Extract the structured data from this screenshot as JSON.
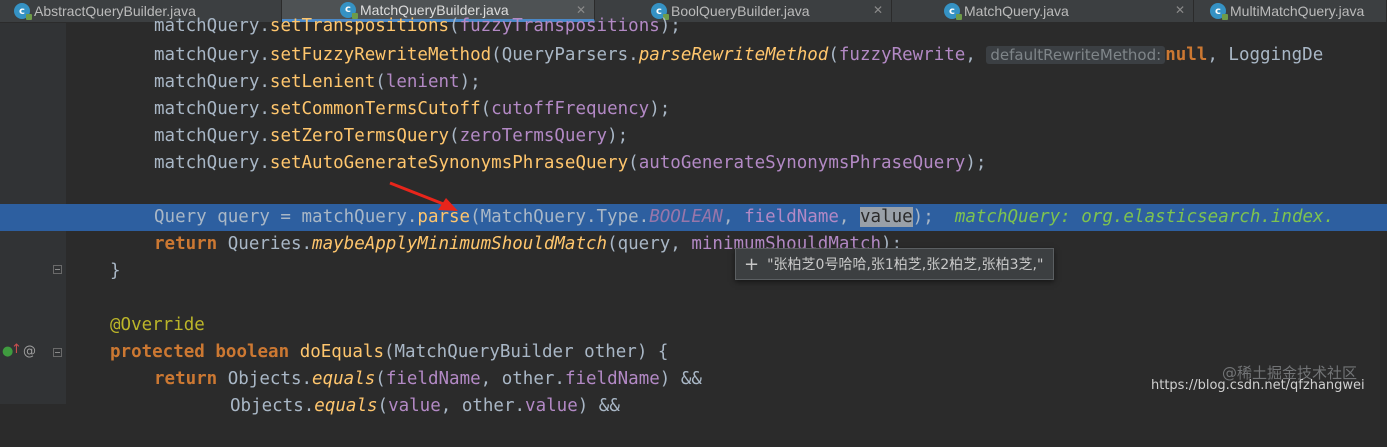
{
  "tabs": [
    {
      "label": "AbstractQueryBuilder.java",
      "active": false
    },
    {
      "label": "MatchQueryBuilder.java",
      "active": true
    },
    {
      "label": "BoolQueryBuilder.java",
      "active": false
    },
    {
      "label": "MatchQuery.java",
      "active": false
    },
    {
      "label": "MultiMatchQuery.java",
      "active": false
    }
  ],
  "code": {
    "line1": {
      "a": "matchQuery.",
      "b": "setTranspositions",
      "c": "(",
      "d": "fuzzyTranspositions",
      "e": ");"
    },
    "line2": {
      "a": "matchQuery.",
      "b": "setFuzzyRewriteMethod",
      "c": "(QueryParsers.",
      "d": "parseRewriteMethod",
      "e": "(",
      "f": "fuzzyRewrite",
      "g": ", ",
      "hint": "defaultRewriteMethod:",
      "h": "null",
      "i": ", LoggingDe"
    },
    "line3": {
      "a": "matchQuery.",
      "b": "setLenient",
      "c": "(",
      "d": "lenient",
      "e": ");"
    },
    "line4": {
      "a": "matchQuery.",
      "b": "setCommonTermsCutoff",
      "c": "(",
      "d": "cutoffFrequency",
      "e": ");"
    },
    "line5": {
      "a": "matchQuery.",
      "b": "setZeroTermsQuery",
      "c": "(",
      "d": "zeroTermsQuery",
      "e": ");"
    },
    "line6": {
      "a": "matchQuery.",
      "b": "setAutoGenerateSynonymsPhraseQuery",
      "c": "(",
      "d": "autoGenerateSynonymsPhraseQuery",
      "e": ");"
    },
    "line8": {
      "a": "Query query = matchQuery.",
      "b": "parse",
      "c": "(MatchQuery.Type.",
      "d": "BOOLEAN",
      "e": ", ",
      "f": "fieldName",
      "g": ", ",
      "h": "value",
      "i": ");",
      "inline": "matchQuery: org.elasticsearch.index."
    },
    "line9": {
      "kw": "return",
      "a": " Queries.",
      "b": "maybeApplyMinimumShouldMatch",
      "c": "(query, ",
      "d": "minimumShouldMatch",
      "e": ");"
    },
    "line10": {
      "a": "}"
    },
    "line12": {
      "a": "@Override"
    },
    "line13": {
      "k1": "protected",
      "k2": "boolean",
      "b": "doEquals",
      "c": "(MatchQueryBuilder other) {"
    },
    "line14": {
      "kw": "return",
      "a": " Objects.",
      "b": "equals",
      "c": "(",
      "d": "fieldName",
      "e": ", other.",
      "f": "fieldName",
      "g": ") &&"
    },
    "line15": {
      "a": "Objects.",
      "b": "equals",
      "c": "(",
      "d": "value",
      "e": ", other.",
      "f": "value",
      "g": ") &&"
    }
  },
  "tooltip": {
    "text": "\"张柏芝0号哈哈,张1柏芝,张2柏芝,张柏3芝,\""
  },
  "watermark": {
    "juejin": "@稀土掘金技术社区",
    "csdn": "https://blog.csdn.net/qfzhangwei"
  },
  "colors": {
    "editor_bg": "#2b2b2b",
    "highlight": "#2d5fa0",
    "method": "#ffc66d",
    "keyword": "#cc7832",
    "param": "#b389c5",
    "arrow": "#e8251b"
  }
}
